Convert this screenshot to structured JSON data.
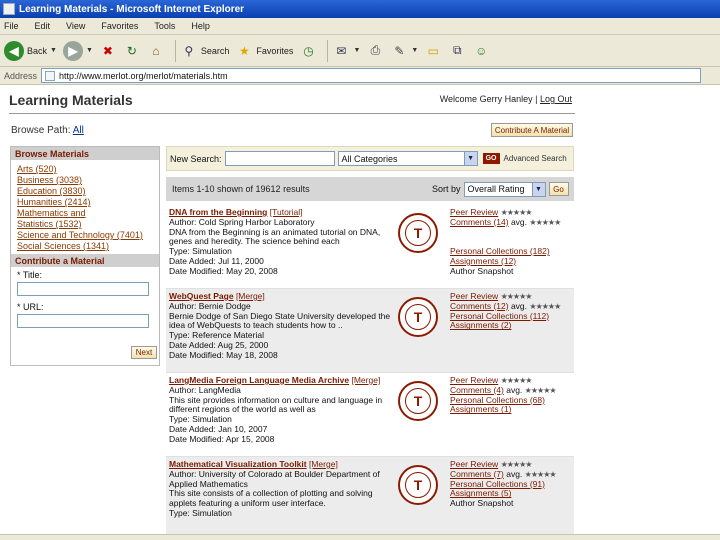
{
  "window": {
    "title": "Learning Materials - Microsoft Internet Explorer"
  },
  "menu": [
    "File",
    "Edit",
    "View",
    "Favorites",
    "Tools",
    "Help"
  ],
  "toolbar": {
    "back_label": "Back",
    "search_label": "Search",
    "favorites_label": "Favorites"
  },
  "address": {
    "label": "Address",
    "url": "http://www.merlot.org/merlot/materials.htm"
  },
  "page": {
    "title": "Learning Materials",
    "welcome": "Welcome Gerry Hanley",
    "separator": "|",
    "logout": "Log Out",
    "browse_path_label": "Browse Path:",
    "browse_path_link": "All",
    "contribute_button": "Contribute A Material"
  },
  "sidebar": {
    "browse_header": "Browse Materials",
    "categories": [
      "Arts (520)",
      "Business (3038)",
      "Education (3830)",
      "Humanities (2414)",
      "Mathematics and",
      "Statistics (1532)",
      "Science and Technology (7401)",
      "Social Sciences (1341)"
    ],
    "contribute_header": "Contribute a Material",
    "title_label": "* Title:",
    "url_label": "* URL:",
    "next_button": "Next"
  },
  "search": {
    "label": "New Search:",
    "input_value": "",
    "category_value": "All Categories",
    "go": "GO",
    "advanced": "Advanced Search"
  },
  "results_bar": {
    "summary": "Items 1-10 shown of 19612 results",
    "sort_label": "Sort by",
    "sort_value": "Overall Rating",
    "go": "Go"
  },
  "results": [
    {
      "title": "DNA from the Beginning",
      "type_tag": "[Tutorial]",
      "author": "Author: Cold Spring Harbor Laboratory",
      "description": "DNA from the Beginning is an animated tutorial on DNA, genes and heredity. The science behind each",
      "material_type": "Type: Simulation",
      "date_added": "Date Added: Jul 11, 2000",
      "date_modified": "Date Modified: May 20, 2008",
      "peer_review": "Peer Review",
      "peer_stars": "★★★★★",
      "comments": "Comments (14)",
      "comments_avg": "avg.",
      "comments_stars": "★★★★★",
      "personal_collections": "Personal Collections (182)",
      "assignments": "Assignments (12)",
      "author_snapshot": "Author Snapshot"
    },
    {
      "title": "WebQuest Page",
      "type_tag": "[Merge]",
      "author": "Author: Bernie Dodge",
      "description": "Bernie Dodge of San Diego State University developed the idea of WebQuests to teach students how to ..",
      "material_type": "Type: Reference Material",
      "date_added": "Date Added: Aug 25, 2000",
      "date_modified": "Date Modified: May 18, 2008",
      "peer_review": "Peer Review",
      "peer_stars": "★★★★★",
      "comments": "Comments (12)",
      "comments_avg": "avg.",
      "comments_stars": "★★★★★",
      "personal_collections": "Personal Collections (112)",
      "assignments": "Assignments (2)",
      "author_snapshot": ""
    },
    {
      "title": "LangMedia Foreign Language Media Archive",
      "type_tag": "[Merge]",
      "author": "Author: LangMedia",
      "description": "This site provides information on culture and language in different regions of the world as well as",
      "material_type": "Type: Simulation",
      "date_added": "Date Added: Jan 10, 2007",
      "date_modified": "Date Modified: Apr 15, 2008",
      "peer_review": "Peer Review",
      "peer_stars": "★★★★★",
      "comments": "Comments (4)",
      "comments_avg": "avg.",
      "comments_stars": "★★★★★",
      "personal_collections": "Personal Collections (68)",
      "assignments": "Assignments (1)",
      "author_snapshot": ""
    },
    {
      "title": "Mathematical Visualization Toolkit",
      "type_tag": "[Merge]",
      "author": "Author: University of Colorado at Boulder Department of Applied Mathematics",
      "description": "This site consists of a collection of plotting and solving applets featuring a uniform user interface.",
      "material_type": "Type: Simulation",
      "date_added": "",
      "date_modified": "",
      "peer_review": "Peer Review",
      "peer_stars": "★★★★★",
      "comments": "Comments (7)",
      "comments_avg": "avg.",
      "comments_stars": "★★★★★",
      "personal_collections": "Personal Collections (91)",
      "assignments": "Assignments (5)",
      "author_snapshot": "Author Snapshot"
    }
  ]
}
